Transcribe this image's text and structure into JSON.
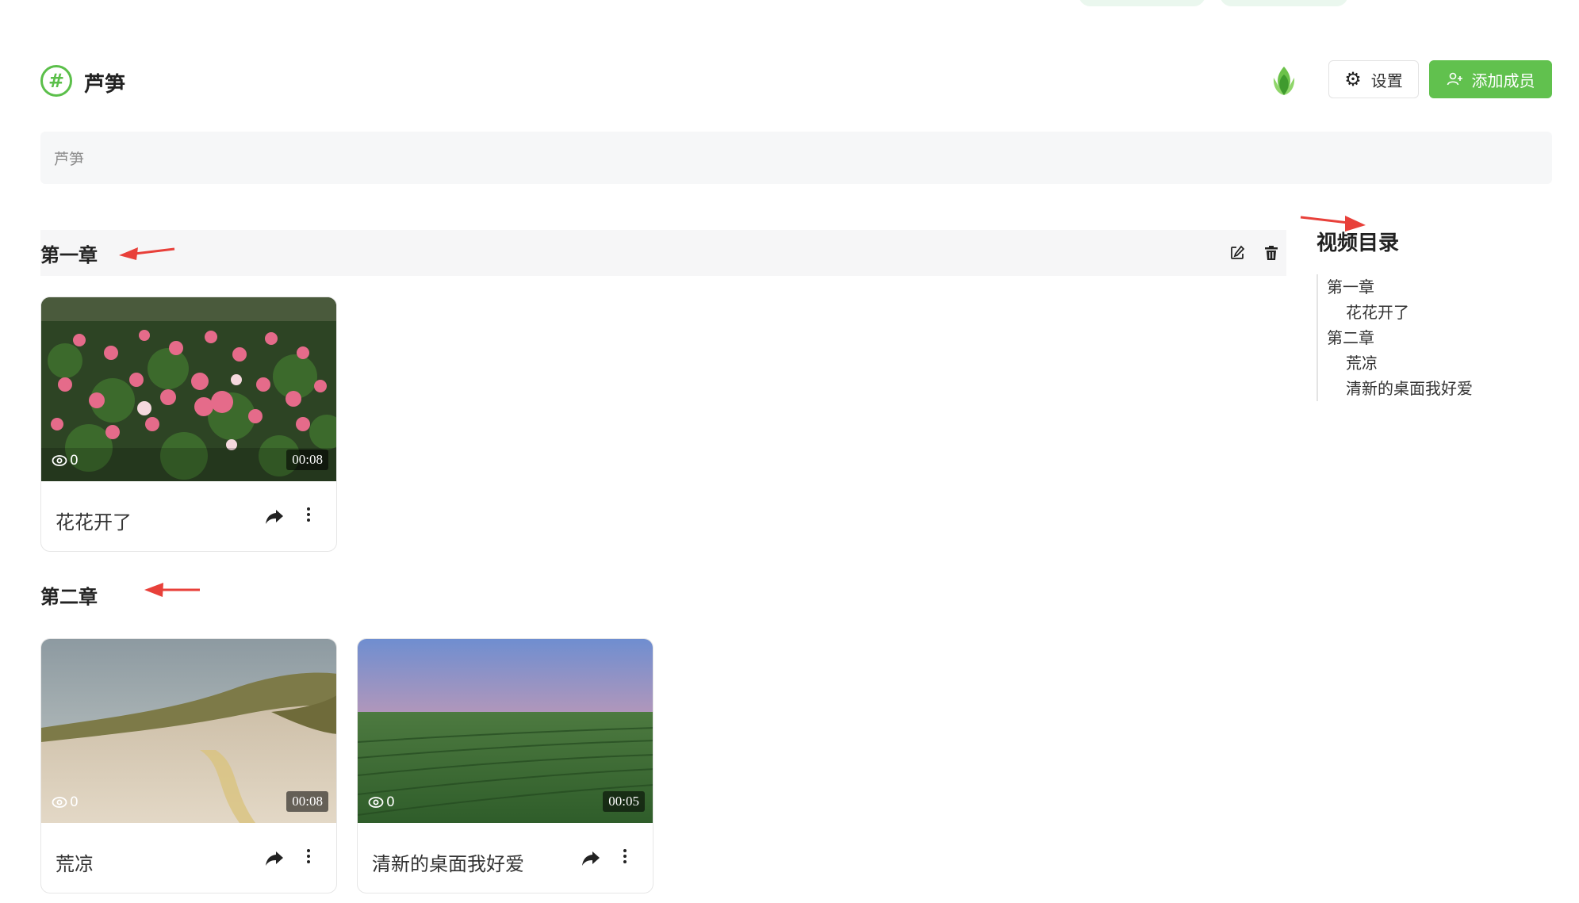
{
  "header": {
    "channel_symbol": "#",
    "channel_title": "芦笋",
    "settings_label": "设置",
    "add_member_label": "添加成员"
  },
  "description": {
    "value": "芦笋"
  },
  "chapters": [
    {
      "title": "第一章",
      "videos": [
        {
          "title": "花花开了",
          "views": "0",
          "duration": "00:08"
        }
      ]
    },
    {
      "title": "第二章",
      "videos": [
        {
          "title": "荒凉",
          "views": "0",
          "duration": "00:08"
        },
        {
          "title": "清新的桌面我好爱",
          "views": "0",
          "duration": "00:05"
        }
      ]
    }
  ],
  "toc": {
    "title": "视频目录",
    "items": [
      {
        "label": "第一章",
        "level": 0
      },
      {
        "label": "花花开了",
        "level": 1
      },
      {
        "label": "第二章",
        "level": 0
      },
      {
        "label": "荒凉",
        "level": 1
      },
      {
        "label": "清新的桌面我好爱",
        "level": 1
      }
    ]
  },
  "colors": {
    "accent": "#61c14e",
    "annotation_arrow": "#e8403a"
  },
  "icons": {
    "channel": "hash-circle-icon",
    "logo": "leaf-logo-icon",
    "settings": "gear-icon",
    "add_member": "add-user-icon",
    "edit": "edit-icon",
    "delete": "trash-icon",
    "views": "eye-icon",
    "share": "share-icon",
    "more": "more-vertical-icon"
  }
}
